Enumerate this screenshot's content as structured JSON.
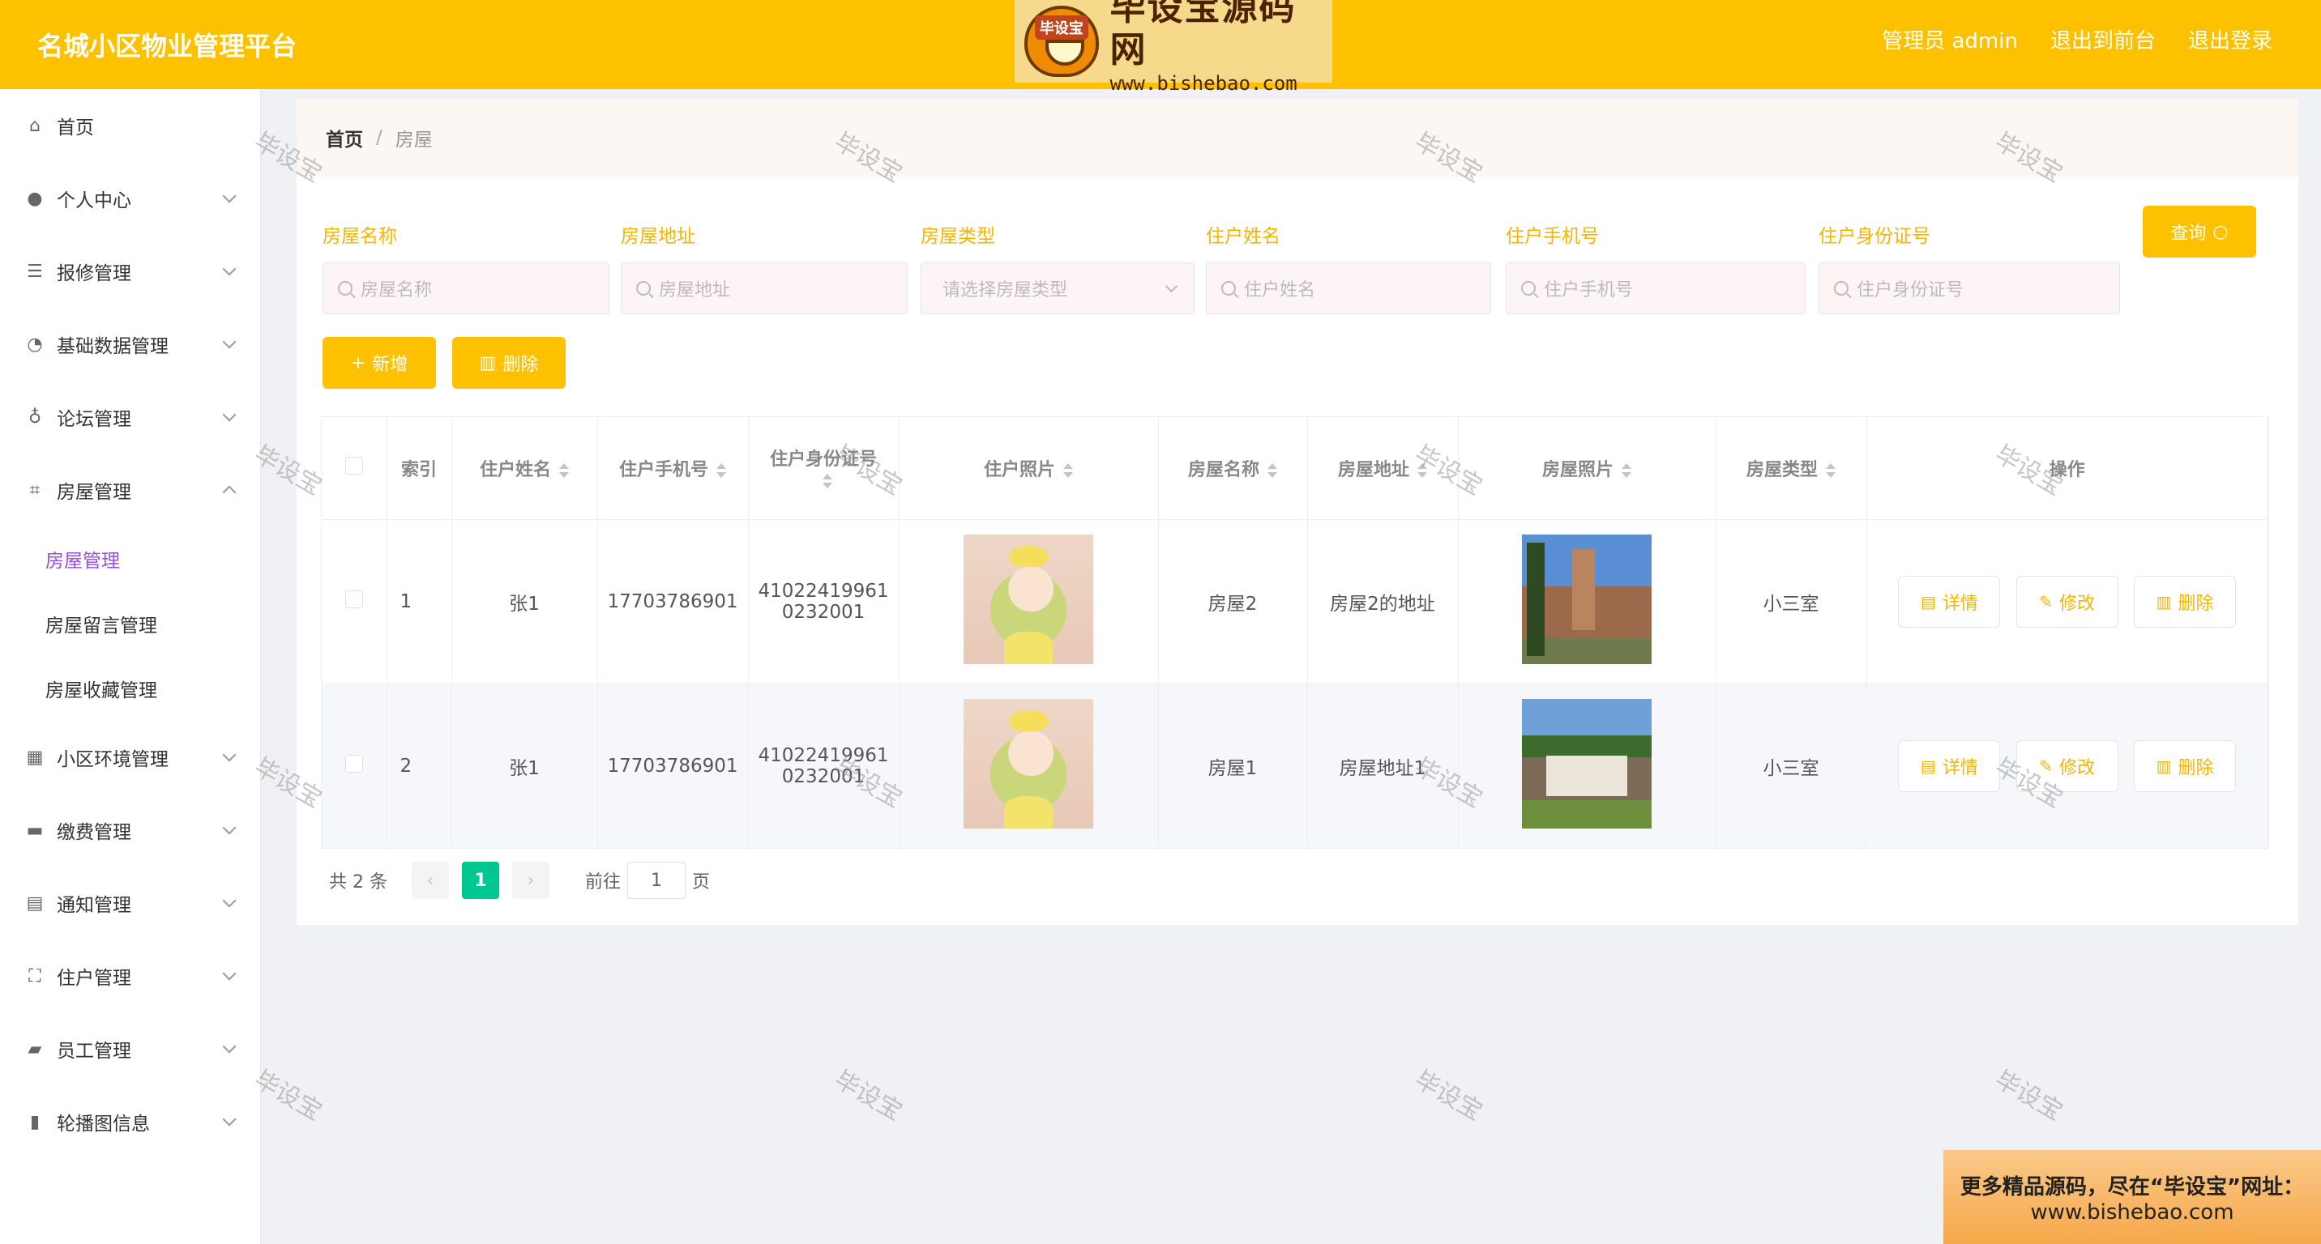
{
  "app": {
    "title": "名城小区物业管理平台"
  },
  "logo": {
    "badge": "毕设宝",
    "name": "毕设宝源码网",
    "url": "www.bishebao.com"
  },
  "header": {
    "user": "管理员 admin",
    "to_front": "退出到前台",
    "logout": "退出登录"
  },
  "sidebar": {
    "items": [
      {
        "label": "首页",
        "icon": "home-icon"
      },
      {
        "label": "个人中心",
        "icon": "user-icon"
      },
      {
        "label": "报修管理",
        "icon": "list-icon"
      },
      {
        "label": "基础数据管理",
        "icon": "dashboard-icon"
      },
      {
        "label": "论坛管理",
        "icon": "microphone-icon"
      },
      {
        "label": "房屋管理",
        "icon": "crop-icon"
      },
      {
        "label": "小区环境管理",
        "icon": "grid-icon"
      },
      {
        "label": "缴费管理",
        "icon": "wallet-icon"
      },
      {
        "label": "通知管理",
        "icon": "message-icon"
      },
      {
        "label": "住户管理",
        "icon": "fullscreen-icon"
      },
      {
        "label": "员工管理",
        "icon": "ticket-icon"
      },
      {
        "label": "轮播图信息",
        "icon": "chart-icon"
      }
    ],
    "sub_items": [
      {
        "label": "房屋管理"
      },
      {
        "label": "房屋留言管理"
      },
      {
        "label": "房屋收藏管理"
      }
    ]
  },
  "breadcrumb": {
    "home": "首页",
    "separator": "/",
    "current": "房屋"
  },
  "filters": [
    {
      "label": "房屋名称",
      "placeholder": "房屋名称"
    },
    {
      "label": "房屋地址",
      "placeholder": "房屋地址"
    },
    {
      "label": "房屋类型",
      "placeholder": "请选择房屋类型"
    },
    {
      "label": "住户姓名",
      "placeholder": "住户姓名"
    },
    {
      "label": "住户手机号",
      "placeholder": "住户手机号"
    },
    {
      "label": "住户身份证号",
      "placeholder": "住户身份证号"
    }
  ],
  "buttons": {
    "query": "查询",
    "add": "新增",
    "delete": "删除"
  },
  "table": {
    "headers": {
      "index": "索引",
      "name": "住户姓名",
      "phone": "住户手机号",
      "id_card": "住户身份证号",
      "photo": "住户照片",
      "house_name": "房屋名称",
      "house_addr": "房屋地址",
      "house_photo": "房屋照片",
      "house_type": "房屋类型",
      "actions": "操作"
    },
    "rows": [
      {
        "index": "1",
        "name": "张1",
        "phone": "17703786901",
        "id_card_1": "41022419961",
        "id_card_2": "0232001",
        "house_name": "房屋2",
        "house_addr": "房屋2的地址",
        "house_type": "小三室"
      },
      {
        "index": "2",
        "name": "张1",
        "phone": "17703786901",
        "id_card_1": "41022419961",
        "id_card_2": "0232001",
        "house_name": "房屋1",
        "house_addr": "房屋地址1",
        "house_type": "小三室"
      }
    ],
    "actions": {
      "detail": "详情",
      "edit": "修改",
      "delete": "删除"
    }
  },
  "pagination": {
    "total": "共 2 条",
    "current": "1",
    "goto": "前往",
    "goto_value": "1",
    "page_unit": "页"
  },
  "watermark": "毕设宝",
  "ad": {
    "line1": "更多精品源码，尽在“毕设宝”网址：",
    "line2": "www.bishebao.com"
  },
  "colors": {
    "primary": "#fec100",
    "accent_text": "#f7b500",
    "active_menu": "#9a4de0",
    "pager_active": "#00c68f"
  }
}
